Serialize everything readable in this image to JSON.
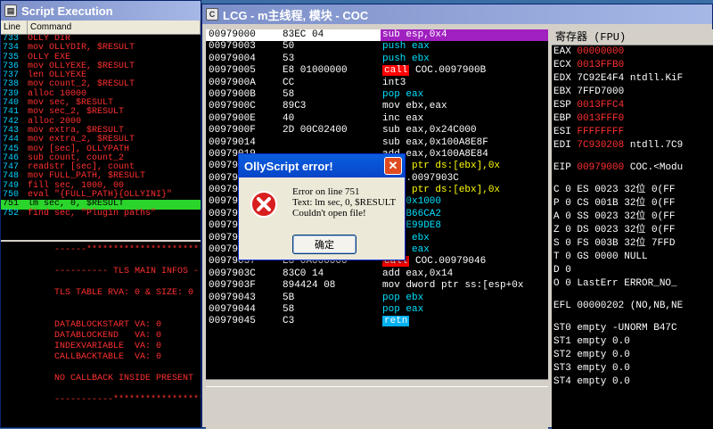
{
  "script_window": {
    "title": "Script Execution",
    "columns": [
      "Line",
      "Command"
    ],
    "rows": [
      {
        "line": "733",
        "cmd": "OLLY DIR"
      },
      {
        "line": "734",
        "cmd": "mov OLLYDIR,   $RESULT"
      },
      {
        "line": "735",
        "cmd": "OLLY EXE"
      },
      {
        "line": "736",
        "cmd": "mov OLLYEXE,   $RESULT"
      },
      {
        "line": "737",
        "cmd": "len OLLYEXE"
      },
      {
        "line": "738",
        "cmd": "mov count_2,   $RESULT"
      },
      {
        "line": "739",
        "cmd": "alloc 10000"
      },
      {
        "line": "740",
        "cmd": "mov sec,  $RESULT"
      },
      {
        "line": "741",
        "cmd": "mov sec_2,  $RESULT"
      },
      {
        "line": "742",
        "cmd": "alloc 2000"
      },
      {
        "line": "743",
        "cmd": "mov extra, $RESULT"
      },
      {
        "line": "744",
        "cmd": "mov extra_2, $RESULT"
      },
      {
        "line": "745",
        "cmd": "mov [sec], OLLYPATH"
      },
      {
        "line": "746",
        "cmd": "sub count, count_2"
      },
      {
        "line": "747",
        "cmd": "readstr [sec], count"
      },
      {
        "line": "748",
        "cmd": "mov FULL_PATH, $RESULT"
      },
      {
        "line": "749",
        "cmd": "fill sec, 1000, 00"
      },
      {
        "line": "750",
        "cmd": "eval \"{FULL_PATH}{OLLYINI}\""
      },
      {
        "line": "751",
        "cmd": "lm sec, 0, $RESULT"
      },
      {
        "line": "752",
        "cmd": "find sec, \"Plugin paths\""
      }
    ],
    "current_row": 18,
    "log": [
      "------**********************",
      "",
      "---------- TLS MAIN INFOS --",
      "",
      "TLS TABLE RVA: 0 & SIZE: 0",
      "",
      "",
      "DATABLOCKSTART VA: 0",
      "DATABLOCKEND   VA: 0",
      "INDEXVARIABLE  VA: 0",
      "CALLBACKTABLE  VA: 0",
      "",
      "NO CALLBACK INSIDE PRESENT",
      "",
      "-----------**********************"
    ]
  },
  "cpu_window": {
    "title": "LCG - m主线程, 模块 - COC",
    "disasm": [
      {
        "addr": "00979000",
        "hex": "83EC 04",
        "parts": [
          [
            "w",
            "sub "
          ],
          [
            "w",
            "esp,0x4"
          ]
        ],
        "sel": true
      },
      {
        "addr": "00979003",
        "hex": "50",
        "parts": [
          [
            "c",
            "push "
          ],
          [
            "c",
            "eax"
          ]
        ]
      },
      {
        "addr": "00979004",
        "hex": "53",
        "parts": [
          [
            "c",
            "push "
          ],
          [
            "c",
            "ebx"
          ]
        ]
      },
      {
        "addr": "00979005",
        "hex": "E8 01000000",
        "parts": [
          [
            "call",
            "call"
          ],
          [
            "w",
            " COC.0097900B"
          ]
        ]
      },
      {
        "addr": "0097900A",
        "hex": "CC",
        "parts": [
          [
            "w",
            "int3"
          ]
        ]
      },
      {
        "addr": "0097900B",
        "hex": "58",
        "parts": [
          [
            "c",
            "pop "
          ],
          [
            "c",
            "eax"
          ]
        ]
      },
      {
        "addr": "0097900C",
        "hex": "89C3",
        "parts": [
          [
            "w",
            "mov "
          ],
          [
            "w",
            "ebx,eax"
          ]
        ]
      },
      {
        "addr": "0097900E",
        "hex": "40",
        "parts": [
          [
            "w",
            "inc "
          ],
          [
            "w",
            "eax"
          ]
        ]
      },
      {
        "addr": "0097900F",
        "hex": "2D 00C02400",
        "parts": [
          [
            "w",
            "sub "
          ],
          [
            "w",
            "eax,0x24C000"
          ]
        ]
      },
      {
        "addr": "00979014",
        "hex": "",
        "parts": [
          [
            "w",
            "sub "
          ],
          [
            "w",
            "eax,0x100A8E8F"
          ]
        ]
      },
      {
        "addr": "00979019",
        "hex": "",
        "parts": [
          [
            "w",
            "add "
          ],
          [
            "w",
            "eax,0x100A8E84"
          ]
        ]
      },
      {
        "addr": "0097901E",
        "hex": "",
        "parts": [
          [
            "y",
            "byte ptr ds:[ebx],0x"
          ]
        ]
      },
      {
        "addr": "00979021",
        "hex": "",
        "parts": [
          [
            "w",
            "XCOC.0097903C"
          ]
        ]
      },
      {
        "addr": "00979026",
        "hex": "",
        "parts": [
          [
            "y",
            "byte ptr ds:[ebx],0x"
          ]
        ]
      },
      {
        "addr": "00979029",
        "hex": "",
        "parts": [
          [
            "c",
            "ebx,0x1000"
          ]
        ]
      },
      {
        "addr": "0097902F",
        "hex": "",
        "parts": [
          [
            "c",
            "0x57B66CA2"
          ]
        ]
      },
      {
        "addr": "00979034",
        "hex": "",
        "parts": [
          [
            "c",
            "0x76E99DE8"
          ]
        ]
      },
      {
        "addr": "00979035",
        "hex": "53",
        "parts": [
          [
            "c",
            "push "
          ],
          [
            "c",
            "ebx"
          ]
        ]
      },
      {
        "addr": "00979036",
        "hex": "50",
        "parts": [
          [
            "c",
            "push "
          ],
          [
            "c",
            "eax"
          ]
        ]
      },
      {
        "addr": "00979037",
        "hex": "E8 0A000000",
        "parts": [
          [
            "call",
            "call"
          ],
          [
            "w",
            " COC.00979046"
          ]
        ]
      },
      {
        "addr": "0097903C",
        "hex": "83C0 14",
        "parts": [
          [
            "w",
            "add "
          ],
          [
            "w",
            "eax,0x14"
          ]
        ]
      },
      {
        "addr": "0097903F",
        "hex": "894424 08",
        "parts": [
          [
            "w",
            "mov "
          ],
          [
            "w",
            "dword ptr ss:[esp+0x"
          ]
        ]
      },
      {
        "addr": "00979043",
        "hex": "5B",
        "parts": [
          [
            "c",
            "pop "
          ],
          [
            "c",
            "ebx"
          ]
        ]
      },
      {
        "addr": "00979044",
        "hex": "58",
        "parts": [
          [
            "c",
            "pop "
          ],
          [
            "c",
            "eax"
          ]
        ]
      },
      {
        "addr": "00979045",
        "hex": "C3",
        "parts": [
          [
            "retn",
            "retn"
          ]
        ]
      }
    ],
    "regs_header": "寄存器 (FPU)",
    "regs": [
      {
        "name": "EAX",
        "val": "00000000",
        "red": true,
        "extra": ""
      },
      {
        "name": "ECX",
        "val": "0013FFB0",
        "red": true,
        "extra": ""
      },
      {
        "name": "EDX",
        "val": "7C92E4F4",
        "red": false,
        "extra": "ntdll.KiF"
      },
      {
        "name": "EBX",
        "val": "7FFD7000",
        "red": false,
        "extra": ""
      },
      {
        "name": "ESP",
        "val": "0013FFC4",
        "red": true,
        "extra": ""
      },
      {
        "name": "EBP",
        "val": "0013FFF0",
        "red": true,
        "extra": ""
      },
      {
        "name": "ESI",
        "val": "FFFFFFFF",
        "red": true,
        "extra": ""
      },
      {
        "name": "EDI",
        "val": "7C930208",
        "red": true,
        "extra": "ntdll.7C9"
      },
      {
        "gap": true
      },
      {
        "name": "EIP",
        "val": "00979000",
        "red": true,
        "extra": "COC.<Modu"
      },
      {
        "gap": true
      },
      {
        "text": "C 0   ES 0023 32位 0(FF"
      },
      {
        "text": "P 0   CS 001B 32位 0(FF"
      },
      {
        "text": "A 0   SS 0023 32位 0(FF"
      },
      {
        "text": "Z 0   DS 0023 32位 0(FF"
      },
      {
        "text": "S 0   FS 003B 32位 7FFD"
      },
      {
        "text": "T 0   GS 0000 NULL"
      },
      {
        "text": "D 0"
      },
      {
        "text": "O 0   LastErr ERROR_NO_"
      },
      {
        "gap": true
      },
      {
        "text": "EFL 00000202 (NO,NB,NE"
      },
      {
        "gap": true
      },
      {
        "text": "ST0 empty -UNORM B47C"
      },
      {
        "text": "ST1 empty 0.0"
      },
      {
        "text": "ST2 empty 0.0"
      },
      {
        "text": "ST3 empty 0.0"
      },
      {
        "text": "ST4 empty 0.0"
      }
    ]
  },
  "dialog": {
    "title": "OllyScript error!",
    "close": "✕",
    "line1": "Error on line 751",
    "line2": "Text: lm sec, 0, $RESULT",
    "line3": "Couldn't open file!",
    "ok": "确定"
  }
}
